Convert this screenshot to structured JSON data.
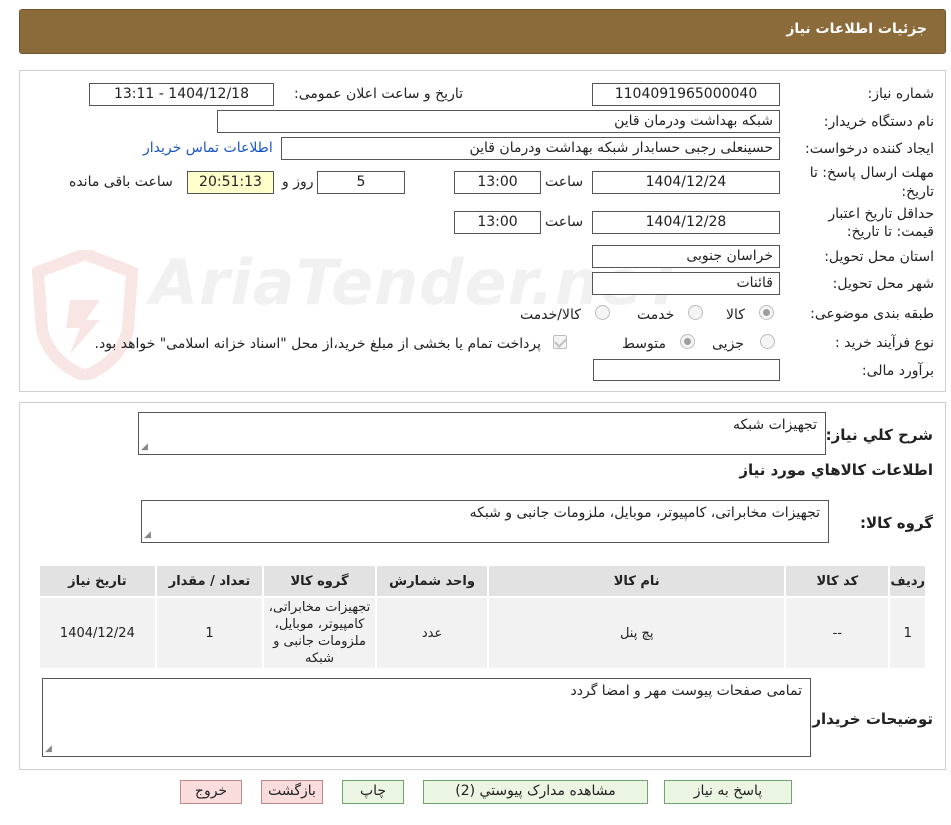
{
  "header": {
    "title": "جزئیات اطلاعات نیاز"
  },
  "form": {
    "need_number_label": "شماره نیاز:",
    "need_number": "1104091965000040",
    "announce_label": "تاریخ و ساعت اعلان عمومی:",
    "announce_value": "1404/12/18 - 13:11",
    "buyer_org_label": "نام دستگاه خریدار:",
    "buyer_org": "شبکه بهداشت ودرمان قاین",
    "creator_label": "ایجاد کننده درخواست:",
    "creator": "حسینعلی رجبی حسابدار شبکه بهداشت ودرمان قاین",
    "contact_link": "اطلاعات تماس خریدار",
    "deadline_label_1": "مهلت ارسال پاسخ: تا",
    "deadline_label_2": "تاریخ:",
    "deadline_date": "1404/12/24",
    "time_label": "ساعت",
    "deadline_time": "13:00",
    "days_value": "5",
    "days_label": "روز و",
    "remaining_time": "20:51:13",
    "remaining_label": "ساعت باقی مانده",
    "validity_label_1": "حداقل تاریخ اعتبار",
    "validity_label_2": "قیمت: تا تاریخ:",
    "validity_date": "1404/12/28",
    "validity_time": "13:00",
    "province_label": "استان محل تحویل:",
    "province": "خراسان جنوبی",
    "city_label": "شهر محل تحویل:",
    "city": "قائنات",
    "category_label": "طبقه بندی موضوعی:",
    "category_options": [
      "کالا",
      "خدمت",
      "کالا/خدمت"
    ],
    "category_selected": "کالا",
    "process_label": "نوع فرآیند خرید :",
    "process_options": [
      "جزیی",
      "متوسط"
    ],
    "process_selected": "متوسط",
    "payment_note": "پرداخت تمام یا بخشی از مبلغ خرید،از محل \"اسناد خزانه اسلامی\" خواهد بود.",
    "estimate_label": "برآورد مالی:",
    "estimate_value": ""
  },
  "details": {
    "summary_label": "شرح کلي نياز:",
    "summary": "تجهیزات شبکه",
    "goods_info_title": "اطلاعات کالاهاي مورد نياز",
    "goods_group_label": "گروه کالا:",
    "goods_group": "تجهیزات مخابراتی، کامپیوتر، موبایل، ملزومات جانبی و شبکه",
    "table": {
      "headers": [
        "ردیف",
        "کد کالا",
        "نام کالا",
        "واحد شمارش",
        "گروه کالا",
        "تعداد / مقدار",
        "تاریخ نیاز"
      ],
      "rows": [
        [
          "1",
          "--",
          "پچ پنل",
          "عدد",
          "تجهیزات مخابراتی، کامپیوتر، موبایل، ملزومات جانبی و شبکه",
          "1",
          "1404/12/24"
        ]
      ]
    },
    "buyer_notes_label": "توضیحات خریدار:",
    "buyer_notes": "تمامی صفحات پیوست مهر و امضا گردد"
  },
  "buttons": {
    "reply": "پاسخ به نياز",
    "attachments": "مشاهده مدارک پيوستي (2)",
    "print": "چاپ",
    "back": "بازگشت",
    "exit": "خروج"
  },
  "watermark": {
    "text": "AriaTender.neT"
  },
  "colors": {
    "header_bg": "#8c6b3b",
    "link": "#1a56c4",
    "button_green": "#eaf6e2",
    "button_red": "#fbdcdc",
    "remaining_bg": "#ffffcc"
  }
}
